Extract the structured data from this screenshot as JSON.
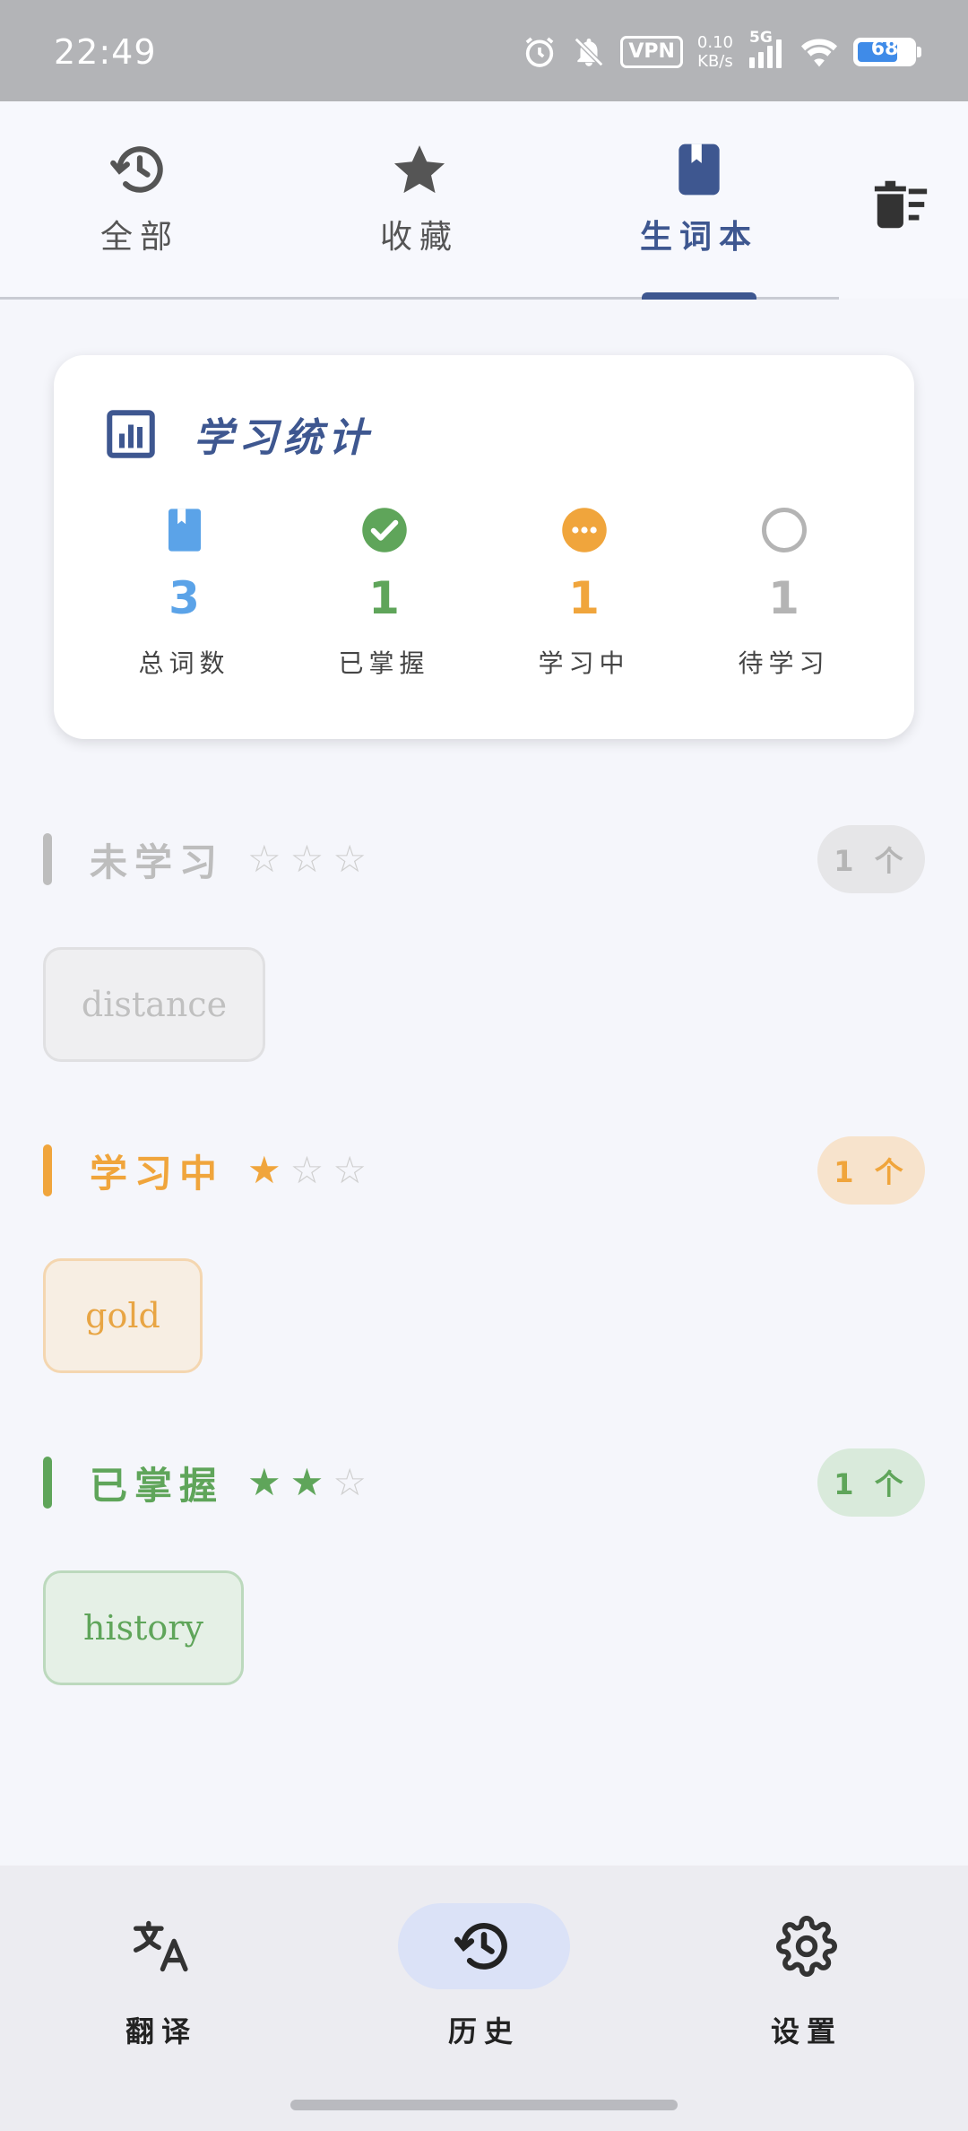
{
  "status_bar": {
    "time": "22:49",
    "vpn": "VPN",
    "speed_value": "0.10",
    "speed_unit": "KB/s",
    "network": "5G",
    "battery": "68",
    "battery_level": 0.68
  },
  "tabs": [
    {
      "label": "全部",
      "icon": "history-icon"
    },
    {
      "label": "收藏",
      "icon": "star-icon"
    },
    {
      "label": "生词本",
      "icon": "bookmark-icon"
    }
  ],
  "active_tab": "生词本",
  "stats": {
    "title": "学习统计",
    "items": [
      {
        "value": "3",
        "label": "总词数",
        "color": "#5ba3e8",
        "icon": "bookmark-icon"
      },
      {
        "value": "1",
        "label": "已掌握",
        "color": "#5fa55a",
        "icon": "check-circle-icon"
      },
      {
        "value": "1",
        "label": "学习中",
        "color": "#f0a53c",
        "icon": "dots-circle-icon"
      },
      {
        "value": "1",
        "label": "待学习",
        "color": "#b4b4b4",
        "icon": "empty-circle-icon"
      }
    ]
  },
  "sections": [
    {
      "title": "未学习",
      "stars_filled": 0,
      "stars_total": 3,
      "count": "1 个",
      "color": "#bdbdbd",
      "words": [
        "distance"
      ]
    },
    {
      "title": "学习中",
      "stars_filled": 1,
      "stars_total": 3,
      "count": "1 个",
      "color": "#f0a53c",
      "words": [
        "gold"
      ]
    },
    {
      "title": "已掌握",
      "stars_filled": 2,
      "stars_total": 3,
      "count": "1 个",
      "color": "#5fa55a",
      "words": [
        "history"
      ]
    }
  ],
  "bottom_nav": [
    {
      "label": "翻译",
      "icon": "translate-icon"
    },
    {
      "label": "历史",
      "icon": "history-icon"
    },
    {
      "label": "设置",
      "icon": "gear-icon"
    }
  ],
  "active_nav": "历史"
}
